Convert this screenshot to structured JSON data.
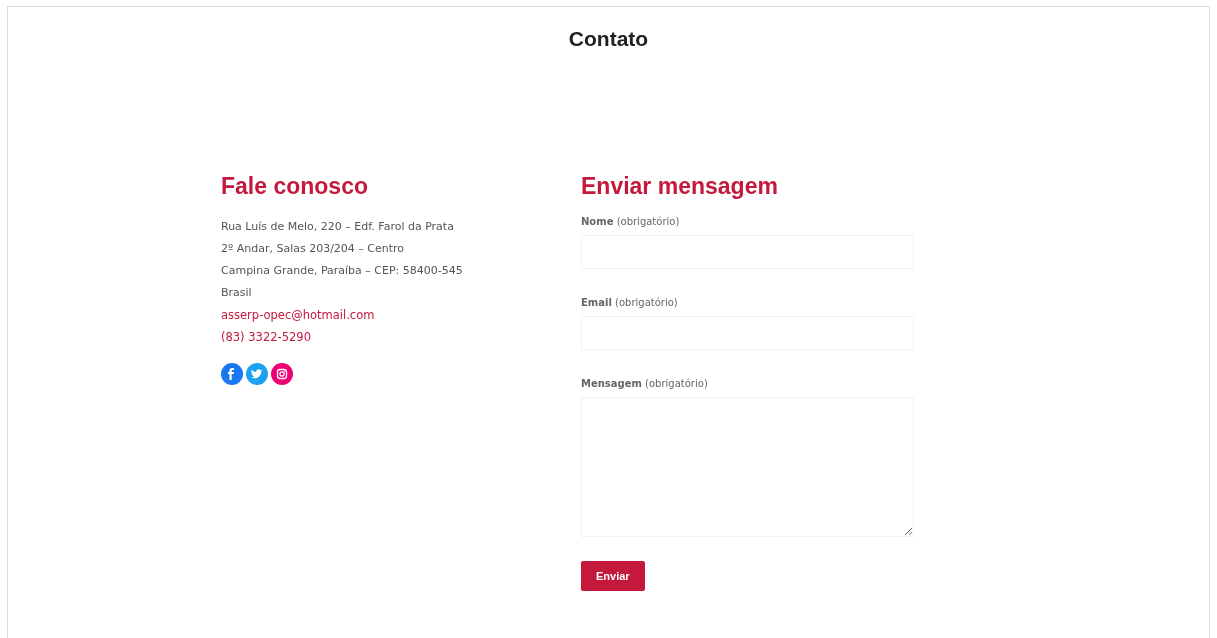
{
  "page_title": "Contato",
  "contact": {
    "heading": "Fale conosco",
    "address_lines": [
      "Rua Luís de Melo, 220 – Edf. Farol da Prata",
      "2º Andar, Salas 203/204 – Centro",
      "Campina Grande, Paraíba – CEP: 58400-545",
      "Brasil"
    ],
    "email": "asserp-opec@hotmail.com",
    "phone": "(83) 3322-5290",
    "social": [
      {
        "kind": "facebook",
        "color": "#1877f2"
      },
      {
        "kind": "twitter",
        "color": "#1da1f2"
      },
      {
        "kind": "instagram",
        "color": "#f00075"
      }
    ]
  },
  "form": {
    "heading": "Enviar mensagem",
    "fields": [
      {
        "kind": "text",
        "label": "**Nome** (obrigatório)"
      },
      {
        "kind": "text",
        "label": "**Email** (obrigatório)"
      },
      {
        "kind": "textarea",
        "label": "**Mensagem** (obrigatório)"
      }
    ],
    "submit": "Enviar"
  }
}
